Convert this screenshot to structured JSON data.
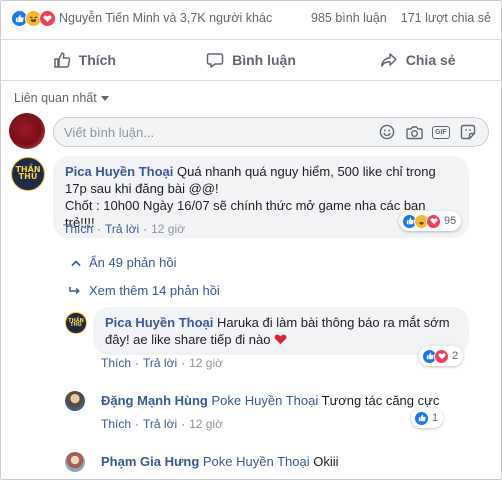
{
  "summary": {
    "names": "Nguyễn Tiến Minh và 3,7K người khác",
    "comments_count": "985 bình luận",
    "shares_count": "171 lượt chia sẻ"
  },
  "actions": {
    "like": "Thích",
    "comment": "Bình luận",
    "share": "Chia sẻ"
  },
  "sort_label": "Liên quan nhất",
  "composer": {
    "placeholder": "Viết bình luận..."
  },
  "comments": [
    {
      "author": "Pica Huyền Thoại",
      "avatar_text": "THẦN THÚ",
      "text_1": "Quá nhanh quá nguy hiểm, 500 like chỉ trong",
      "text_2": "17p sau khi đăng bài @@!",
      "text_3": "Chốt : 10h00 Ngày 16/07 sẽ chính thức mở game nha các bạn trẻ!!!!",
      "like": "Thích",
      "reply": "Trả lời",
      "time": "12 giờ",
      "reaction_count": "95"
    }
  ],
  "thread": {
    "hide_replies": "Ẩn 49 phản hồi",
    "more_replies": "Xem thêm 14 phản hồi"
  },
  "replies": [
    {
      "author": "Pica Huyền Thoại",
      "avatar_text": "THẦN THÚ",
      "text_1": "Haruka đi làm bài thông báo ra mắt sớm",
      "text_2": "đây! ae like share tiếp đi nào",
      "like": "Thích",
      "reply": "Trả lời",
      "time": "12 giờ",
      "reaction_count": "2"
    },
    {
      "author": "Đặng Mạnh Hùng",
      "mention": "Poke Huyền Thoại",
      "text": "Tương tác căng cực",
      "like": "Thích",
      "reply": "Trả lời",
      "time": "12 giờ",
      "reaction_count": "1"
    },
    {
      "author": "Phạm Gia Hưng",
      "mention": "Poke Huyền Thoại",
      "text": "Okiii"
    }
  ],
  "colors": {
    "link": "#385898",
    "like_blue": "#1877f2",
    "love_red": "#f33e58",
    "haha_yellow": "#f7b928"
  }
}
